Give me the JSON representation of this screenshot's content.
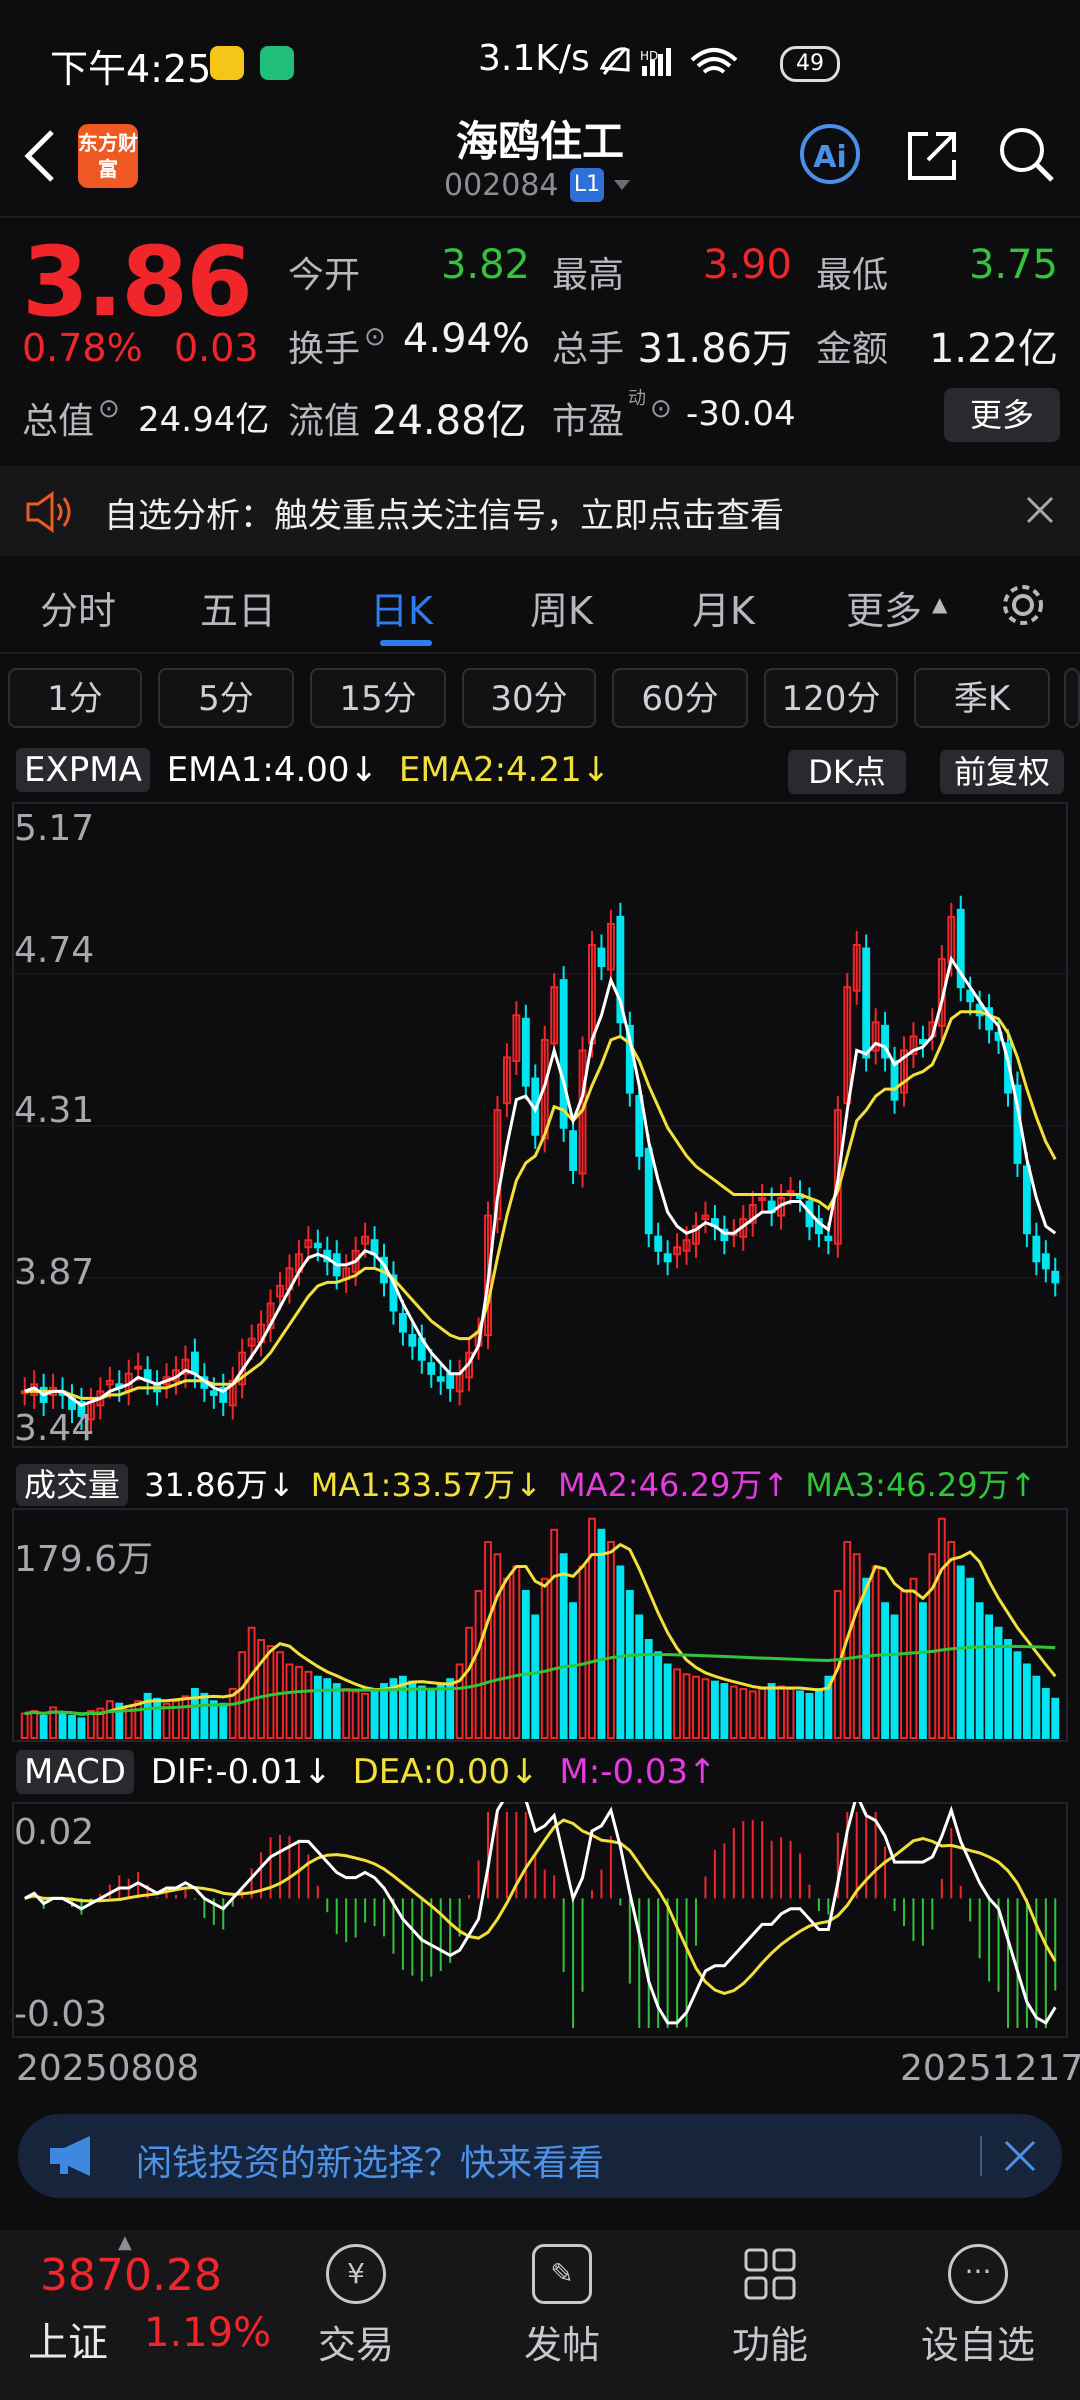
{
  "status": {
    "time": "下午4:25",
    "speed": "3.1K/s",
    "net": "HD",
    "battery": "49"
  },
  "header": {
    "back": "back",
    "logo": "东方财富",
    "title": "海鸥住工",
    "code": "002084",
    "level": "L1",
    "ai": "Ai"
  },
  "quote": {
    "price": "3.86",
    "pct": "0.78%",
    "chg": "0.03",
    "open_label": "今开",
    "open": "3.82",
    "high_label": "最高",
    "high": "3.90",
    "low_label": "最低",
    "low": "3.75",
    "turnover_label": "换手",
    "turnover": "4.94%",
    "vol_label": "总手",
    "vol": "31.86万",
    "amount_label": "金额",
    "amount": "1.22亿",
    "mcap_label": "总值",
    "mcap": "24.94亿",
    "float_label": "流值",
    "float": "24.88亿",
    "pe_label": "市盈",
    "pe_sup": "动",
    "pe": "-30.04",
    "more": "更多"
  },
  "notice": {
    "text": "自选分析：触发重点关注信号，立即点击查看"
  },
  "tabs": [
    "分时",
    "五日",
    "日K",
    "周K",
    "月K",
    "更多"
  ],
  "active_tab": 2,
  "periods": [
    "1分",
    "5分",
    "15分",
    "30分",
    "60分",
    "120分",
    "季K"
  ],
  "main_ind": {
    "name": "EXPMA",
    "ema1": "EMA1:4.00",
    "ema2": "EMA2:4.21",
    "dk": "DK点",
    "fq": "前复权"
  },
  "price_axis": [
    "5.17",
    "4.74",
    "4.31",
    "3.87",
    "3.44"
  ],
  "vol_ind": {
    "name": "成交量",
    "cur": "31.86万",
    "ma1": "MA1:33.57万",
    "ma2": "MA2:46.29万",
    "ma3": "MA3:46.29万",
    "axis_top": "179.6万"
  },
  "macd_ind": {
    "name": "MACD",
    "dif": "DIF:-0.01",
    "dea": "DEA:0.00",
    "m": "M:-0.03",
    "axis_top": "0.02",
    "axis_bottom": "-0.03"
  },
  "dates": {
    "start": "20250808",
    "end": "20251217"
  },
  "ad": {
    "text": "闲钱投资的新选择？快来看看"
  },
  "bottom": {
    "index_value": "3870.28",
    "index_name": "上证",
    "index_pct": "1.19%",
    "nav": [
      "交易",
      "发帖",
      "功能",
      "设自选"
    ]
  },
  "colors": {
    "up": "#f0262b",
    "down": "#00e5f0",
    "ema1": "#ffffff",
    "ema2": "#f2e03a",
    "accent": "#2d7df0"
  },
  "chart_data": {
    "type": "candlestick",
    "price_range": [
      3.44,
      5.17
    ],
    "closes": [
      3.55,
      3.57,
      3.52,
      3.56,
      3.54,
      3.5,
      3.48,
      3.52,
      3.55,
      3.58,
      3.56,
      3.6,
      3.62,
      3.58,
      3.55,
      3.59,
      3.61,
      3.64,
      3.6,
      3.56,
      3.54,
      3.52,
      3.58,
      3.66,
      3.7,
      3.74,
      3.8,
      3.85,
      3.9,
      3.94,
      3.98,
      3.96,
      3.92,
      3.88,
      3.9,
      3.95,
      3.99,
      3.94,
      3.86,
      3.78,
      3.72,
      3.68,
      3.64,
      3.6,
      3.58,
      3.56,
      3.6,
      3.66,
      3.72,
      4.05,
      4.35,
      4.5,
      4.62,
      4.42,
      4.28,
      4.55,
      4.7,
      4.3,
      4.18,
      4.52,
      4.82,
      4.76,
      4.88,
      4.6,
      4.4,
      4.22,
      4.0,
      3.95,
      3.92,
      3.96,
      3.98,
      4.02,
      4.05,
      4.02,
      3.98,
      4.0,
      4.04,
      4.08,
      4.1,
      4.06,
      4.1,
      4.12,
      4.1,
      4.02,
      4.0,
      3.98,
      4.35,
      4.7,
      4.82,
      4.5,
      4.6,
      4.5,
      4.38,
      4.52,
      4.56,
      4.54,
      4.6,
      4.78,
      4.9,
      4.7,
      4.66,
      4.62,
      4.58,
      4.55,
      4.4,
      4.2,
      4.0,
      3.92,
      3.9,
      3.86
    ],
    "volume_range": [
      0,
      179.6
    ],
    "volumes": [
      20,
      22,
      18,
      25,
      20,
      18,
      16,
      22,
      24,
      30,
      28,
      26,
      30,
      36,
      32,
      28,
      30,
      34,
      40,
      36,
      30,
      28,
      40,
      70,
      90,
      80,
      75,
      70,
      60,
      58,
      54,
      50,
      48,
      44,
      40,
      38,
      36,
      40,
      44,
      48,
      50,
      46,
      42,
      40,
      44,
      48,
      60,
      90,
      120,
      160,
      150,
      130,
      140,
      120,
      100,
      130,
      170,
      150,
      110,
      140,
      179,
      170,
      160,
      140,
      120,
      100,
      80,
      70,
      60,
      56,
      52,
      50,
      48,
      46,
      44,
      42,
      40,
      38,
      40,
      44,
      42,
      40,
      38,
      36,
      40,
      50,
      120,
      160,
      150,
      130,
      140,
      110,
      100,
      120,
      130,
      110,
      150,
      179,
      160,
      140,
      130,
      110,
      100,
      90,
      80,
      70,
      60,
      50,
      40,
      32
    ],
    "ema1": [
      3.55,
      3.56,
      3.54,
      3.55,
      3.55,
      3.53,
      3.51,
      3.52,
      3.53,
      3.55,
      3.56,
      3.57,
      3.59,
      3.58,
      3.57,
      3.58,
      3.59,
      3.61,
      3.6,
      3.58,
      3.56,
      3.55,
      3.57,
      3.61,
      3.65,
      3.69,
      3.74,
      3.79,
      3.84,
      3.89,
      3.93,
      3.94,
      3.93,
      3.91,
      3.91,
      3.92,
      3.95,
      3.94,
      3.91,
      3.86,
      3.8,
      3.75,
      3.7,
      3.66,
      3.63,
      3.6,
      3.6,
      3.63,
      3.68,
      3.86,
      4.1,
      4.25,
      4.38,
      4.39,
      4.35,
      4.42,
      4.52,
      4.43,
      4.32,
      4.39,
      4.55,
      4.62,
      4.72,
      4.66,
      4.55,
      4.42,
      4.26,
      4.15,
      4.06,
      4.02,
      4.0,
      4.01,
      4.03,
      4.02,
      4.0,
      4.0,
      4.02,
      4.04,
      4.06,
      4.06,
      4.08,
      4.09,
      4.09,
      4.06,
      4.03,
      4.01,
      4.15,
      4.35,
      4.52,
      4.51,
      4.54,
      4.53,
      4.48,
      4.5,
      4.52,
      4.53,
      4.56,
      4.66,
      4.78,
      4.74,
      4.7,
      4.66,
      4.62,
      4.59,
      4.49,
      4.36,
      4.21,
      4.1,
      4.02,
      4.0
    ],
    "ema2": [
      3.55,
      3.55,
      3.55,
      3.55,
      3.55,
      3.54,
      3.53,
      3.53,
      3.53,
      3.54,
      3.54,
      3.55,
      3.56,
      3.56,
      3.56,
      3.56,
      3.57,
      3.58,
      3.58,
      3.58,
      3.57,
      3.57,
      3.57,
      3.59,
      3.61,
      3.63,
      3.66,
      3.7,
      3.74,
      3.78,
      3.82,
      3.85,
      3.86,
      3.86,
      3.87,
      3.88,
      3.9,
      3.9,
      3.89,
      3.87,
      3.84,
      3.81,
      3.78,
      3.75,
      3.73,
      3.71,
      3.7,
      3.7,
      3.72,
      3.8,
      3.93,
      4.05,
      4.15,
      4.2,
      4.22,
      4.28,
      4.36,
      4.35,
      4.32,
      4.35,
      4.42,
      4.48,
      4.55,
      4.56,
      4.54,
      4.49,
      4.42,
      4.36,
      4.3,
      4.26,
      4.22,
      4.19,
      4.17,
      4.15,
      4.13,
      4.11,
      4.11,
      4.11,
      4.11,
      4.11,
      4.11,
      4.11,
      4.11,
      4.1,
      4.09,
      4.07,
      4.12,
      4.22,
      4.32,
      4.35,
      4.39,
      4.41,
      4.41,
      4.43,
      4.45,
      4.46,
      4.48,
      4.54,
      4.61,
      4.63,
      4.63,
      4.63,
      4.62,
      4.61,
      4.57,
      4.5,
      4.41,
      4.33,
      4.26,
      4.21
    ],
    "macd_range": [
      -0.03,
      0.02
    ]
  }
}
